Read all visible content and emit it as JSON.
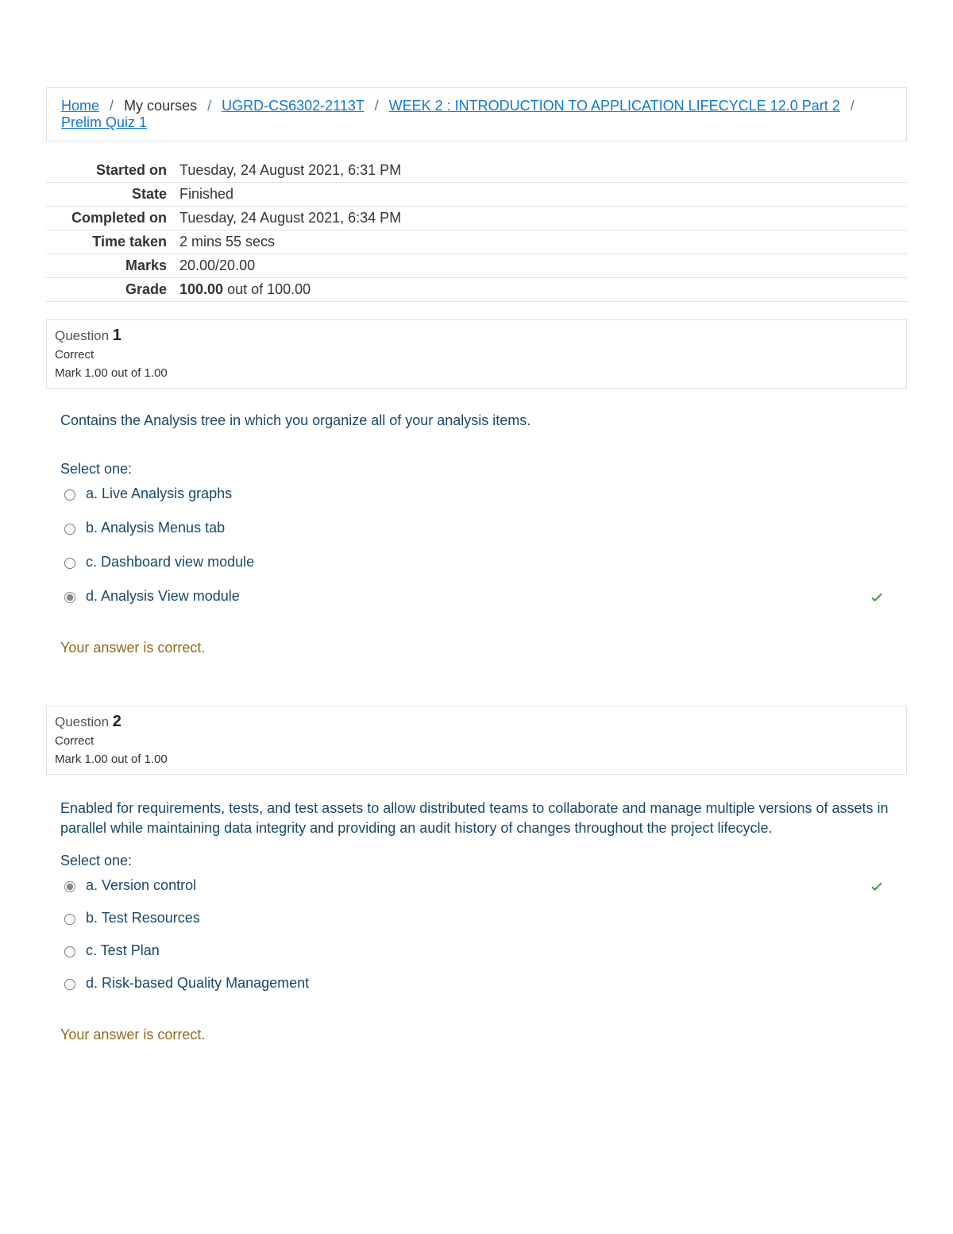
{
  "breadcrumbs": {
    "home": "Home",
    "my_courses": "My courses",
    "course_code": "UGRD-CS6302-2113T",
    "week": "WEEK 2 : INTRODUCTION TO APPLICATION LIFECYCLE 12.0 Part 2",
    "quiz": "Prelim Quiz 1"
  },
  "summary": {
    "rows": {
      "started_on_label": "Started on",
      "started_on_value": "Tuesday, 24 August 2021, 6:31 PM",
      "state_label": "State",
      "state_value": "Finished",
      "completed_on_label": "Completed on",
      "completed_on_value": "Tuesday, 24 August 2021, 6:34 PM",
      "time_taken_label": "Time taken",
      "time_taken_value": "2 mins 55 secs",
      "marks_label": "Marks",
      "marks_value": "20.00/20.00",
      "grade_label": "Grade",
      "grade_strong": "100.00",
      "grade_rest": " out of 100.00"
    }
  },
  "labels": {
    "question_word": "Question",
    "select_one": "Select one:",
    "feedback_correct": "Your answer is correct."
  },
  "q1": {
    "number": "1",
    "status": "Correct",
    "mark": "Mark 1.00 out of 1.00",
    "text": "Contains the Analysis tree in which you organize all of your analysis items.",
    "options": {
      "a": "a. Live Analysis graphs",
      "b": "b. Analysis Menus tab",
      "c": "c. Dashboard view module",
      "d": "d. Analysis View module"
    },
    "selected": "d",
    "correct": "d"
  },
  "q2": {
    "number": "2",
    "status": "Correct",
    "mark": "Mark 1.00 out of 1.00",
    "text": "Enabled for requirements, tests, and test assets to allow distributed teams to collaborate and manage multiple versions of assets in parallel while maintaining data integrity and providing an audit history of changes throughout the project lifecycle.",
    "options": {
      "a": "a. Version control",
      "b": "b. Test Resources",
      "c": "c. Test Plan",
      "d": "d. Risk-based Quality Management"
    },
    "selected": "a",
    "correct": "a"
  }
}
